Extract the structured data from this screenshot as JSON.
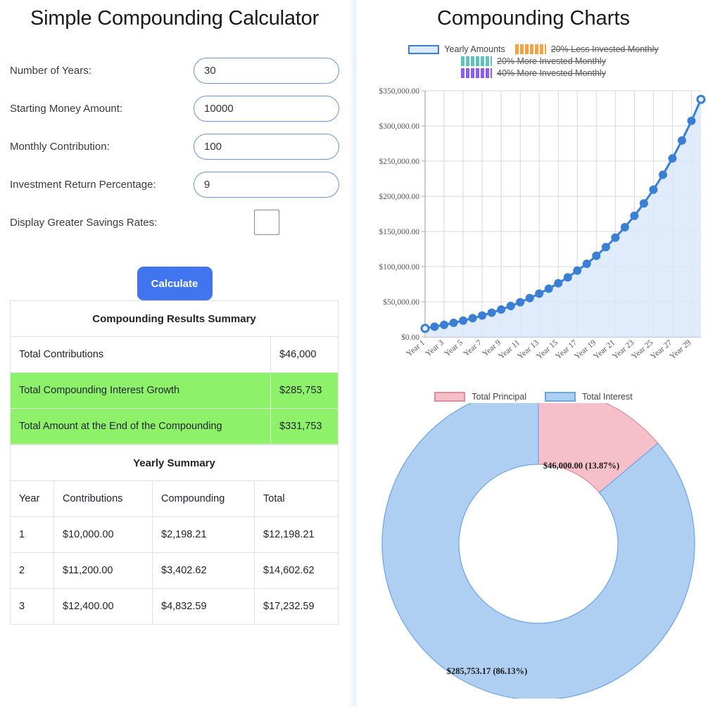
{
  "left": {
    "title": "Simple Compounding Calculator",
    "fields": [
      {
        "label": "Number of Years:",
        "value": "30",
        "name": "years"
      },
      {
        "label": "Starting Money Amount:",
        "value": "10000",
        "name": "starting-amount"
      },
      {
        "label": "Monthly Contribution:",
        "value": "100",
        "name": "monthly-contribution"
      },
      {
        "label": "Investment Return Percentage:",
        "value": "9",
        "name": "return-percentage"
      }
    ],
    "checkbox_label": "Display Greater Savings Rates:",
    "checkbox_checked": false,
    "calculate_label": "Calculate",
    "summary": {
      "caption": "Compounding Results Summary",
      "rows": [
        {
          "label": "Total Contributions",
          "value": "$46,000",
          "highlight": false
        },
        {
          "label": "Total Compounding Interest Growth",
          "value": "$285,753",
          "highlight": true
        },
        {
          "label": "Total Amount at the End of the Compounding",
          "value": "$331,753",
          "highlight": true
        }
      ]
    },
    "yearly": {
      "caption": "Yearly Summary",
      "headers": [
        "Year",
        "Contributions",
        "Compounding",
        "Total"
      ],
      "rows": [
        [
          "1",
          "$10,000.00",
          "$2,198.21",
          "$12,198.21"
        ],
        [
          "2",
          "$11,200.00",
          "$3,402.62",
          "$14,602.62"
        ],
        [
          "3",
          "$12,400.00",
          "$4,832.59",
          "$17,232.59"
        ]
      ]
    }
  },
  "right": {
    "title": "Compounding Charts",
    "line_legend": [
      {
        "label": "Yearly Amounts",
        "color": "#3a7fd5",
        "style": "solid",
        "disabled": false
      },
      {
        "label": "20% Less Invested Monthly",
        "color": "#f5a142",
        "style": "dashed",
        "disabled": true
      },
      {
        "label": "20% More Invested Monthly",
        "color": "#5fc2bb",
        "style": "dashed",
        "disabled": true
      },
      {
        "label": "40% More Invested Monthly",
        "color": "#8b5cf6",
        "style": "dashed",
        "disabled": true
      }
    ],
    "donut_legend": [
      {
        "label": "Total Principal",
        "color": "#f6c0ca"
      },
      {
        "label": "Total Interest",
        "color": "#aecff2"
      }
    ]
  },
  "chart_data": [
    {
      "type": "area",
      "title": "",
      "xlabel": "",
      "ylabel": "",
      "grid": true,
      "legend_position": "top",
      "ylim": [
        0,
        350000
      ],
      "ytick_labels": [
        "$0.00",
        "$50,000.00",
        "$100,000.00",
        "$150,000.00",
        "$200,000.00",
        "$250,000.00",
        "$300,000.00",
        "$350,000.00"
      ],
      "ytick_values": [
        0,
        50000,
        100000,
        150000,
        200000,
        250000,
        300000,
        350000
      ],
      "categories": [
        "Year 1",
        "Year 2",
        "Year 3",
        "Year 4",
        "Year 5",
        "Year 6",
        "Year 7",
        "Year 8",
        "Year 9",
        "Year 10",
        "Year 11",
        "Year 12",
        "Year 13",
        "Year 14",
        "Year 15",
        "Year 16",
        "Year 17",
        "Year 18",
        "Year 19",
        "Year 20",
        "Year 21",
        "Year 22",
        "Year 23",
        "Year 24",
        "Year 25",
        "Year 26",
        "Year 27",
        "Year 28",
        "Year 29",
        "Year 30"
      ],
      "xtick_labels": [
        "Year 1",
        "Year 3",
        "Year 5",
        "Year 7",
        "Year 9",
        "Year 11",
        "Year 13",
        "Year 15",
        "Year 17",
        "Year 19",
        "Year 21",
        "Year 23",
        "Year 25",
        "Year 27",
        "Year 29"
      ],
      "series": [
        {
          "name": "Yearly Amounts",
          "color": "#3a7fd5",
          "fill": "#dbe9fa",
          "values": [
            12198.21,
            14602.62,
            17232.59,
            20108.57,
            23253.12,
            26691.06,
            30449.73,
            34559.15,
            39052.31,
            43965.41,
            49338.14,
            55214.07,
            61640.96,
            68671.22,
            76362.31,
            84777.23,
            94385.12,
            104054.68,
            115363.1,
            127723.68,
            141241.09,
            156029.07,
            172212.24,
            189926.87,
            209321.93,
            230560.21,
            253819.63,
            279294.77,
            307198.6,
            337764.13
          ]
        },
        {
          "name": "20% Less Invested Monthly",
          "color": "#f5a142",
          "values": [],
          "hidden": true
        },
        {
          "name": "20% More Invested Monthly",
          "color": "#5fc2bb",
          "values": [],
          "hidden": true
        },
        {
          "name": "40% More Invested Monthly",
          "color": "#8b5cf6",
          "values": [],
          "hidden": true
        }
      ]
    },
    {
      "type": "pie",
      "variant": "donut",
      "title": "",
      "legend_position": "top",
      "slices": [
        {
          "label": "Total Principal",
          "value": 46000.0,
          "percent": 13.87,
          "color": "#f6c0ca",
          "border": "#e8899c",
          "data_label": "$46,000.00 (13.87%)"
        },
        {
          "label": "Total Interest",
          "value": 285753.17,
          "percent": 86.13,
          "color": "#aecff2",
          "border": "#6aa5e8",
          "data_label": "$285,753.17 (86.13%)"
        }
      ]
    }
  ]
}
